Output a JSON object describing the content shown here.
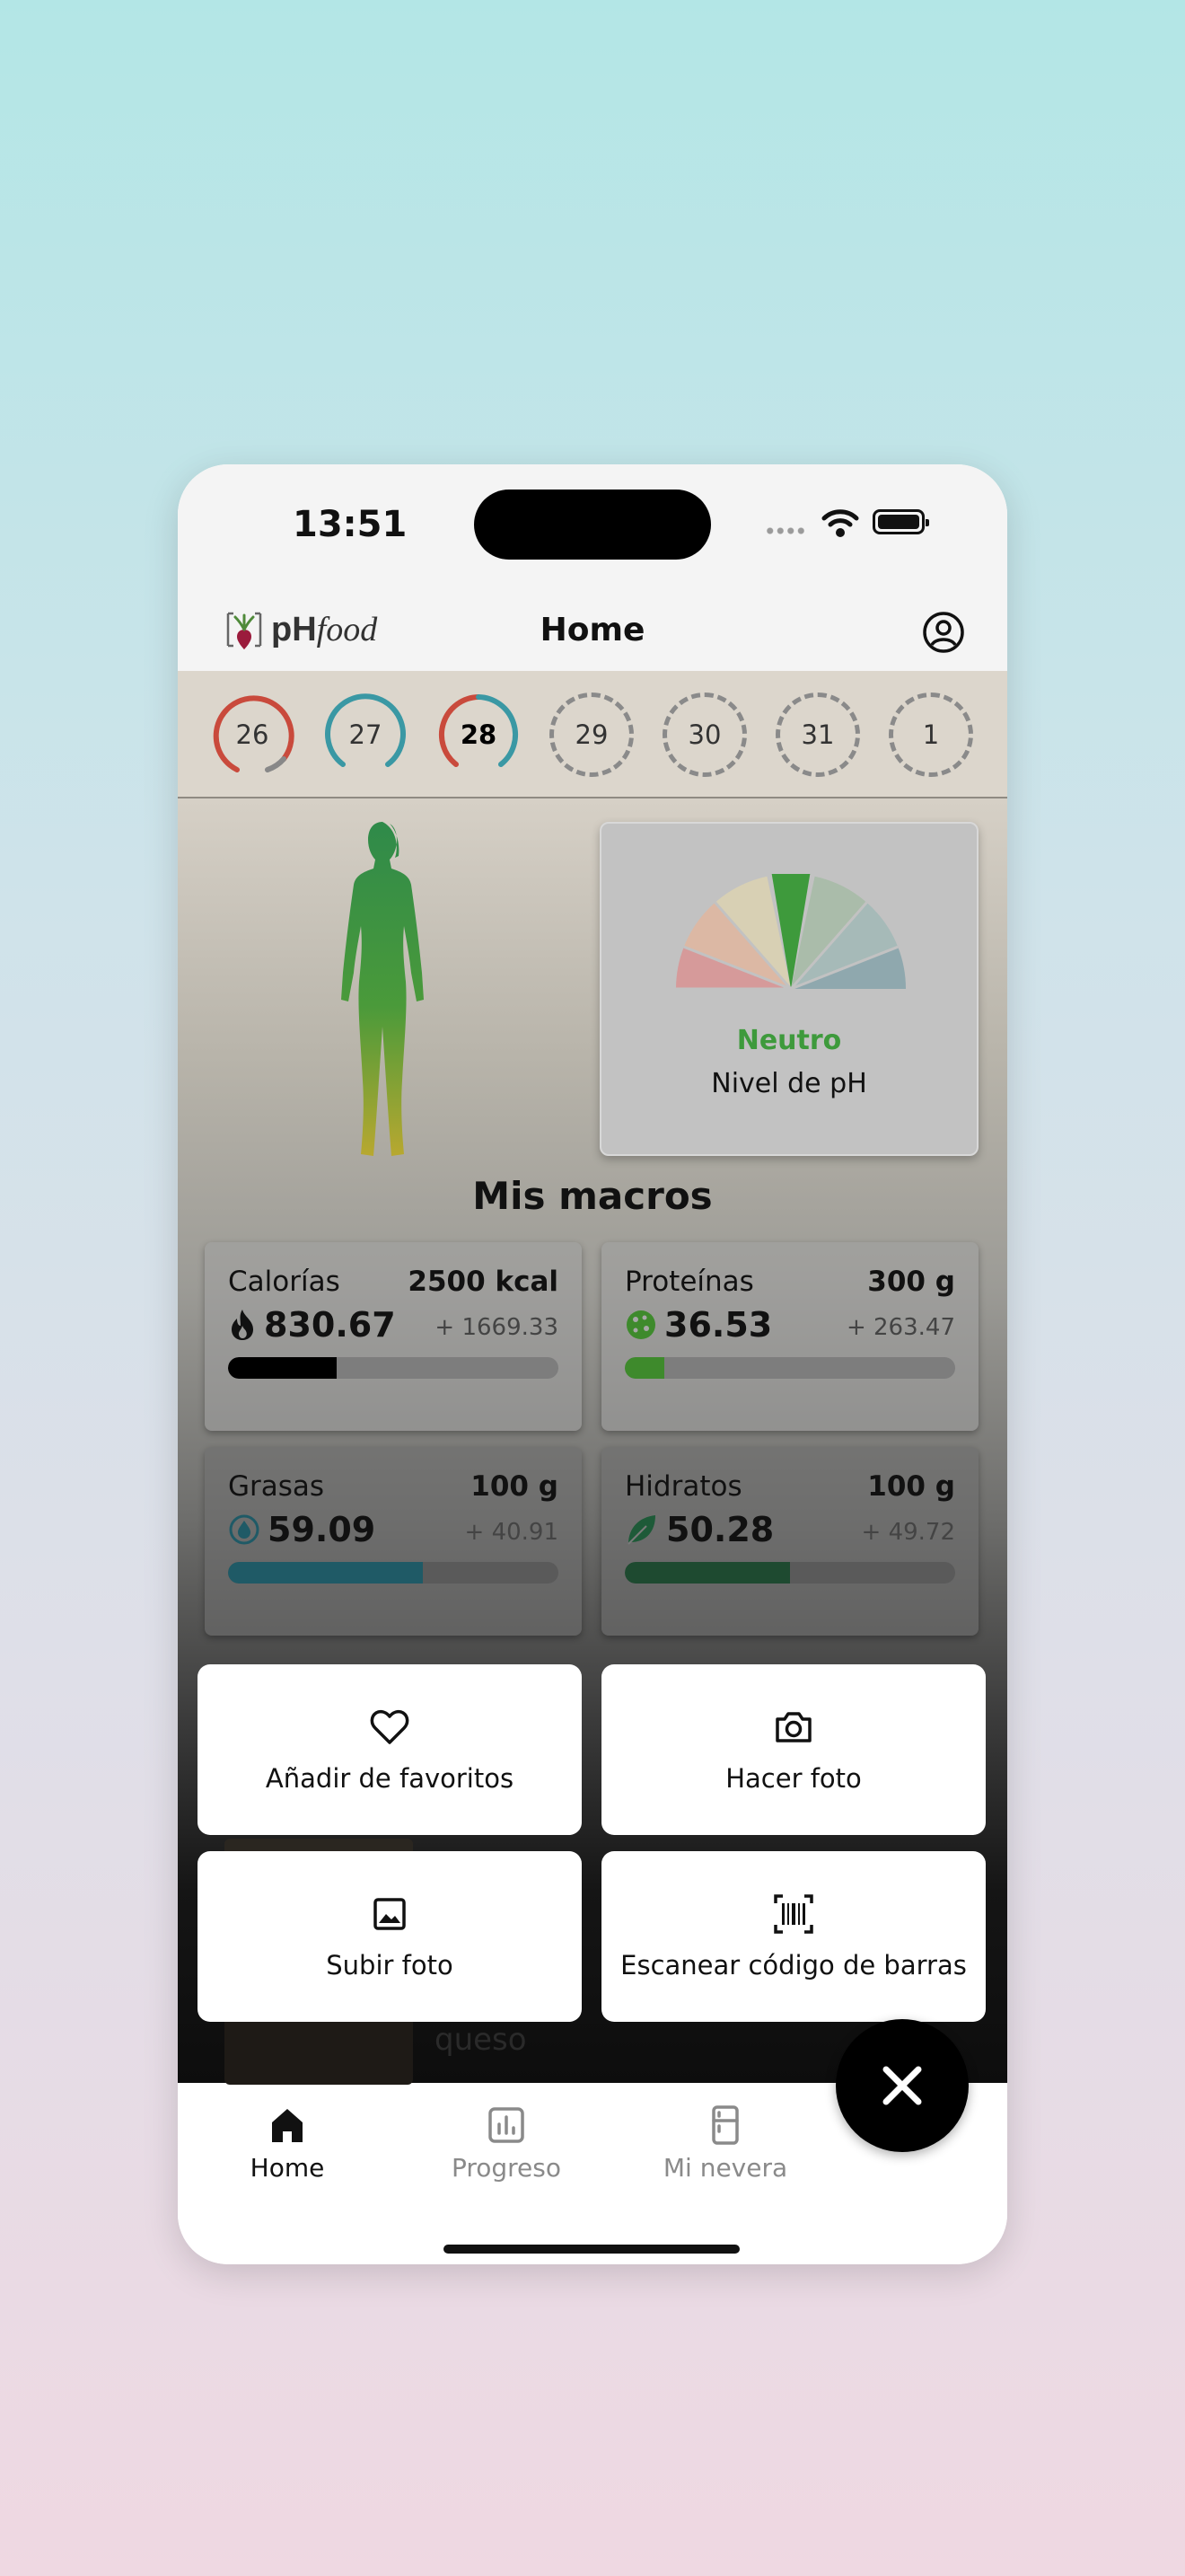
{
  "status": {
    "time": "13:51"
  },
  "header": {
    "title": "Home",
    "logo_ph": "pH",
    "logo_food": "food"
  },
  "days": [
    {
      "label": "26",
      "state": "past",
      "ring": "#c94a3c"
    },
    {
      "label": "27",
      "state": "past",
      "ring": "#3a98a4"
    },
    {
      "label": "28",
      "state": "today",
      "ring": "#c94a3c"
    },
    {
      "label": "29",
      "state": "future"
    },
    {
      "label": "30",
      "state": "future"
    },
    {
      "label": "31",
      "state": "future"
    },
    {
      "label": "1",
      "state": "future"
    }
  ],
  "ph": {
    "status": "Neutro",
    "label": "Nivel de pH",
    "status_color": "#3e9a3c"
  },
  "macros": {
    "title": "Mis macros",
    "items": [
      {
        "name": "Calorías",
        "goal": "2500 kcal",
        "value": "830.67",
        "remaining": "+ 1669.33",
        "progress": 0.33,
        "color": "#000000",
        "icon": "flame-icon"
      },
      {
        "name": "Proteínas",
        "goal": "300 g",
        "value": "36.53",
        "remaining": "+ 263.47",
        "progress": 0.12,
        "color": "#3e8a2c",
        "icon": "cookie-icon"
      },
      {
        "name": "Grasas",
        "goal": "100 g",
        "value": "59.09",
        "remaining": "+ 40.91",
        "progress": 0.59,
        "color": "#1f5a66",
        "icon": "oil-drop-icon"
      },
      {
        "name": "Hidratos",
        "goal": "100 g",
        "value": "50.28",
        "remaining": "+ 49.72",
        "progress": 0.5,
        "color": "#1e4a30",
        "icon": "leaf-icon"
      }
    ]
  },
  "background_text": {
    "partial": "queso"
  },
  "actions": {
    "favorites": "Añadir de favoritos",
    "photo": "Hacer foto",
    "upload": "Subir foto",
    "barcode": "Escanear código de barras"
  },
  "tabs": {
    "home": "Home",
    "progress": "Progreso",
    "fridge": "Mi nevera"
  }
}
